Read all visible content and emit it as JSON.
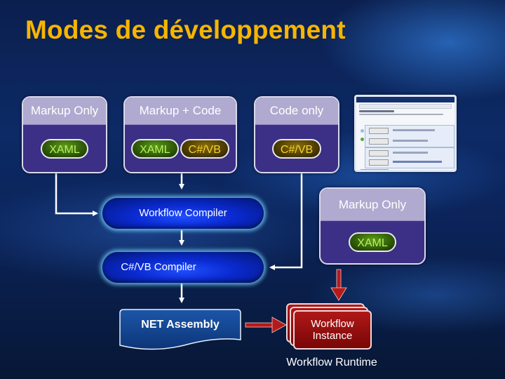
{
  "slide": {
    "title": "Modes de développement"
  },
  "colors": {
    "title": "#f7b500",
    "mode_body": "#3c2f86",
    "mode_header": "#b0aad0",
    "xaml_text": "#b8f060",
    "csvb_text": "#f4d230",
    "compiler": "#0a2ad0",
    "instance": "#9a1010",
    "arrow_red": "#b51a1a"
  },
  "modes": [
    {
      "header": "Markup Only",
      "tags": [
        {
          "label": "XAML",
          "kind": "xaml"
        }
      ]
    },
    {
      "header": "Markup + Code",
      "tags": [
        {
          "label": "XAML",
          "kind": "xaml"
        },
        {
          "label": "C#/VB",
          "kind": "cs"
        }
      ]
    },
    {
      "header": "Code only",
      "tags": [
        {
          "label": "C#/VB",
          "kind": "cs"
        }
      ]
    },
    {
      "header": "Markup Only",
      "tags": [
        {
          "label": "XAML",
          "kind": "xaml"
        }
      ]
    }
  ],
  "compilers": {
    "workflow": "Workflow Compiler",
    "csvb": "C#/VB Compiler"
  },
  "assembly": {
    "label": "NET Assembly"
  },
  "instance": {
    "line1": "Workflow",
    "line2": "Instance"
  },
  "runtime": {
    "label": "Workflow Runtime"
  },
  "designer_screenshot": {
    "description": "workflow designer window thumbnail"
  }
}
